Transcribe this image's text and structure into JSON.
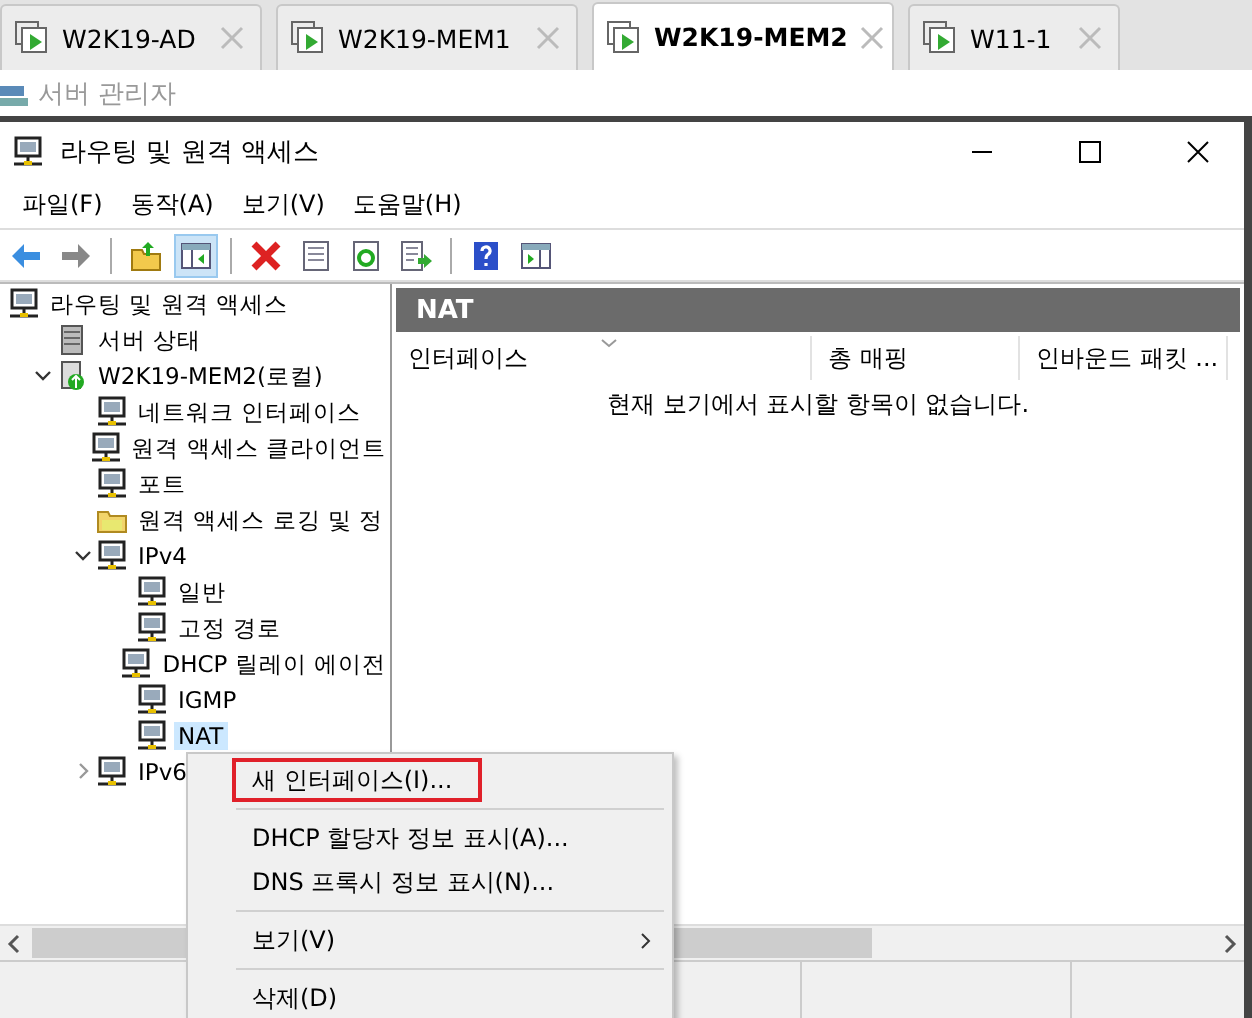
{
  "tabs": [
    {
      "label": "W2K19-AD",
      "selected": false
    },
    {
      "label": "W2K19-MEM1",
      "selected": false
    },
    {
      "label": "W2K19-MEM2",
      "selected": true
    },
    {
      "label": "W11-1",
      "selected": false
    }
  ],
  "app_bar": {
    "title": "서버 관리자"
  },
  "window": {
    "title": "라우팅 및 원격 액세스"
  },
  "menu": [
    "파일(F)",
    "동작(A)",
    "보기(V)",
    "도움말(H)"
  ],
  "toolbar": [
    {
      "kind": "back",
      "pressed": false
    },
    {
      "kind": "forward",
      "pressed": false
    },
    {
      "kind": "sep"
    },
    {
      "kind": "up",
      "pressed": false
    },
    {
      "kind": "tree",
      "pressed": true
    },
    {
      "kind": "sep"
    },
    {
      "kind": "delete",
      "pressed": false
    },
    {
      "kind": "props",
      "pressed": false
    },
    {
      "kind": "refresh",
      "pressed": false
    },
    {
      "kind": "export",
      "pressed": false
    },
    {
      "kind": "sep"
    },
    {
      "kind": "help",
      "pressed": false
    },
    {
      "kind": "panel",
      "pressed": false
    }
  ],
  "tree": [
    {
      "label": "라우팅 및 원격 액세스",
      "kind": "node",
      "selected": false,
      "children": [
        {
          "label": "서버 상태",
          "kind": "server",
          "selected": false
        },
        {
          "label": "W2K19-MEM2(로컬)",
          "kind": "host",
          "selected": false,
          "expanded": true,
          "children": [
            {
              "label": "네트워크 인터페이스",
              "kind": "node",
              "selected": false
            },
            {
              "label": "원격 액세스 클라이언트",
              "kind": "node",
              "selected": false
            },
            {
              "label": "포트",
              "kind": "node",
              "selected": false
            },
            {
              "label": "원격 액세스 로깅 및 정",
              "kind": "folder",
              "selected": false
            },
            {
              "label": "IPv4",
              "kind": "node",
              "selected": false,
              "expanded": true,
              "children": [
                {
                  "label": "일반",
                  "kind": "node",
                  "selected": false
                },
                {
                  "label": "고정 경로",
                  "kind": "node",
                  "selected": false
                },
                {
                  "label": "DHCP 릴레이 에이전",
                  "kind": "node",
                  "selected": false
                },
                {
                  "label": "IGMP",
                  "kind": "node",
                  "selected": false
                },
                {
                  "label": "NAT",
                  "kind": "node",
                  "selected": true
                }
              ]
            },
            {
              "label": "IPv6",
              "kind": "node",
              "selected": false,
              "expanded": false
            }
          ]
        }
      ]
    }
  ],
  "details": {
    "title": "NAT",
    "columns": [
      "인터페이스",
      "총 매핑",
      "인바운드 패킷 ..."
    ],
    "empty_message": "현재 보기에서 표시할 항목이 없습니다."
  },
  "context_menu": [
    {
      "kind": "item",
      "label": "새 인터페이스(I)...",
      "highlighted": true
    },
    {
      "kind": "sep"
    },
    {
      "kind": "item",
      "label": "DHCP 할당자 정보 표시(A)...",
      "highlighted": false
    },
    {
      "kind": "item",
      "label": "DNS 프록시 정보 표시(N)...",
      "highlighted": false
    },
    {
      "kind": "sep"
    },
    {
      "kind": "submenu",
      "label": "보기(V)",
      "highlighted": false
    },
    {
      "kind": "sep"
    },
    {
      "kind": "item",
      "label": "삭제(D)",
      "highlighted": false
    }
  ]
}
